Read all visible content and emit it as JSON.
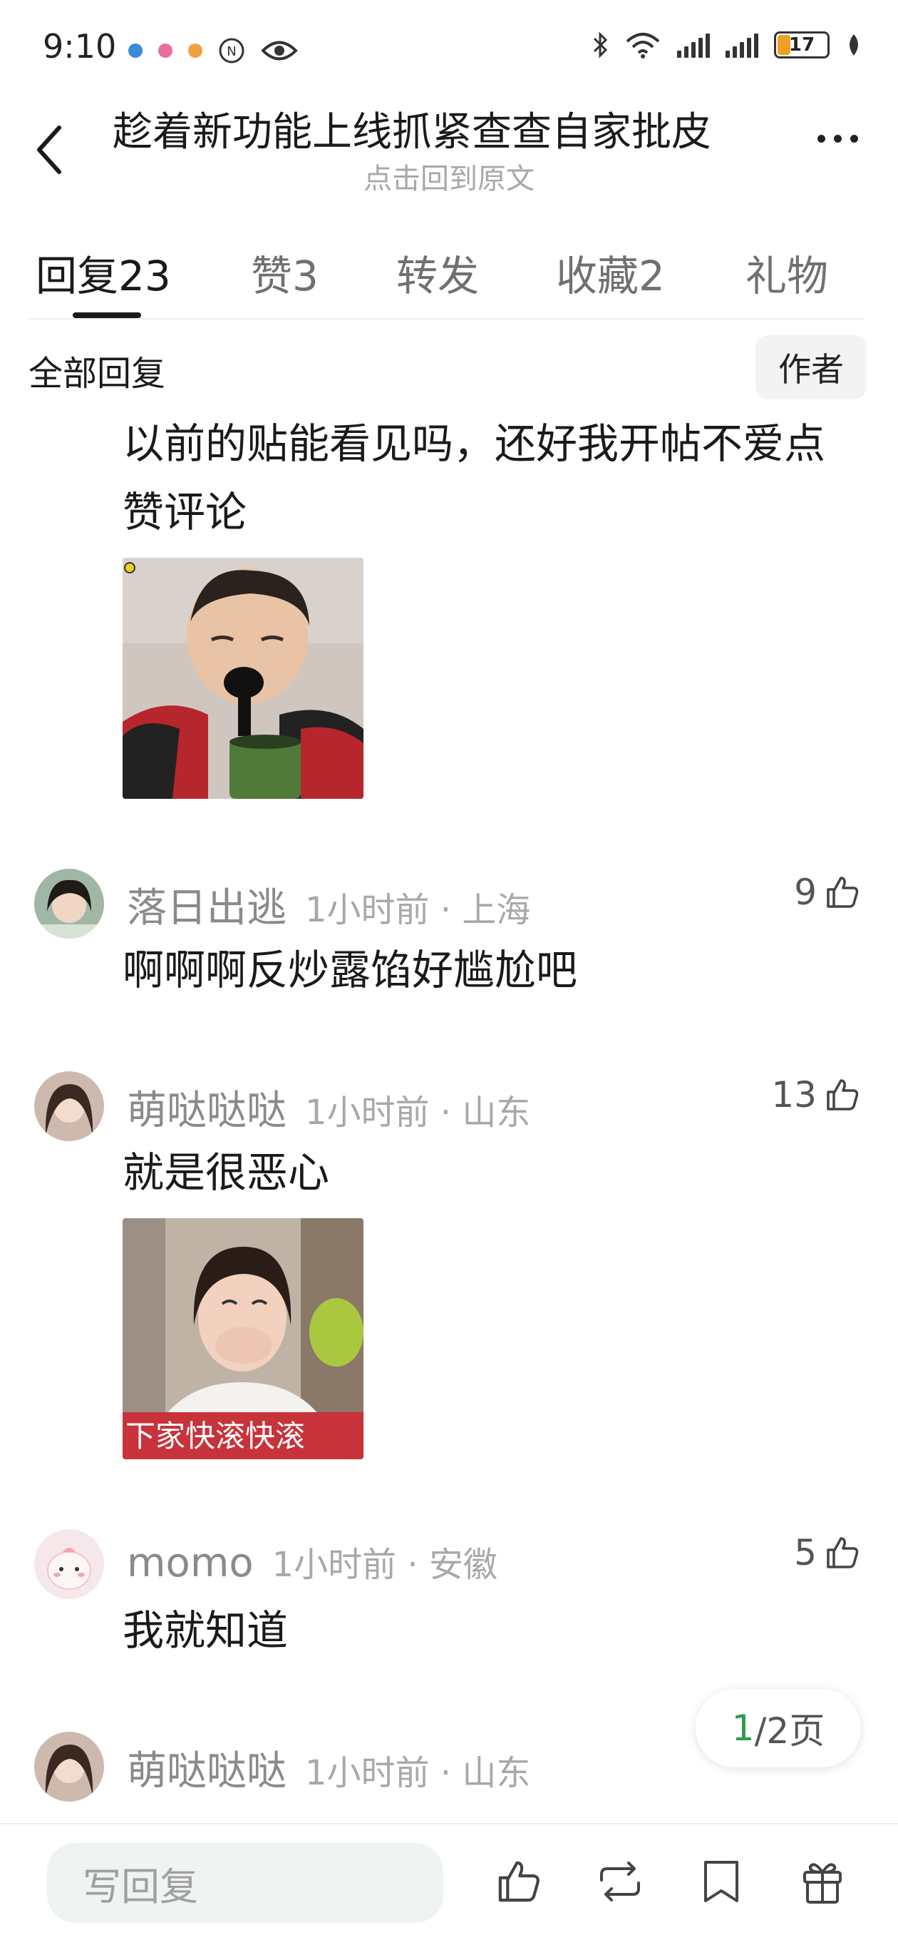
{
  "status_bar": {
    "time": "9:10",
    "battery": "17",
    "left_icons": [
      "app-notification-icon",
      "app-notification-icon",
      "app-notification-icon",
      "nfc-icon",
      "eye-icon"
    ],
    "right_icons": [
      "bluetooth-icon",
      "wifi-icon",
      "signal-icon",
      "signal-icon",
      "battery-icon",
      "leaf-icon"
    ]
  },
  "header": {
    "title": "趁着新功能上线抓紧查查自家批皮",
    "subtitle": "点击回到原文"
  },
  "tabs": [
    {
      "label": "回复",
      "count": "23",
      "active": true
    },
    {
      "label": "赞",
      "count": "3",
      "active": false
    },
    {
      "label": "转发",
      "count": "",
      "active": false
    },
    {
      "label": "收藏",
      "count": "2",
      "active": false
    },
    {
      "label": "礼物",
      "count": "",
      "active": false
    }
  ],
  "section": {
    "title": "全部回复",
    "author_filter": "作者"
  },
  "comments": [
    {
      "text": "以前的贴能看见吗，还好我开帖不爱点赞评论",
      "has_image": true
    },
    {
      "username": "落日出逃",
      "time": "1小时前",
      "location": "上海",
      "likes": "9",
      "text": "啊啊啊反炒露馅好尴尬吧"
    },
    {
      "username": "萌哒哒哒",
      "time": "1小时前",
      "location": "山东",
      "likes": "13",
      "text": "就是很恶心",
      "image_caption": "下家快滚快滚"
    },
    {
      "username": "momo",
      "time": "1小时前",
      "location": "安徽",
      "likes": "5",
      "text": "我就知道"
    },
    {
      "username": "萌哒哒哒",
      "time": "1小时前",
      "location": "山东"
    }
  ],
  "pagination": {
    "current": "1",
    "total_text": "/2页"
  },
  "bottom_bar": {
    "reply_placeholder": "写回复",
    "icons": [
      "like-icon",
      "repost-icon",
      "bookmark-icon",
      "gift-icon"
    ]
  },
  "colors": {
    "accent_green": "#2e9b4c",
    "muted_text": "#a8a8a8",
    "input_bg": "#eff3f1"
  }
}
